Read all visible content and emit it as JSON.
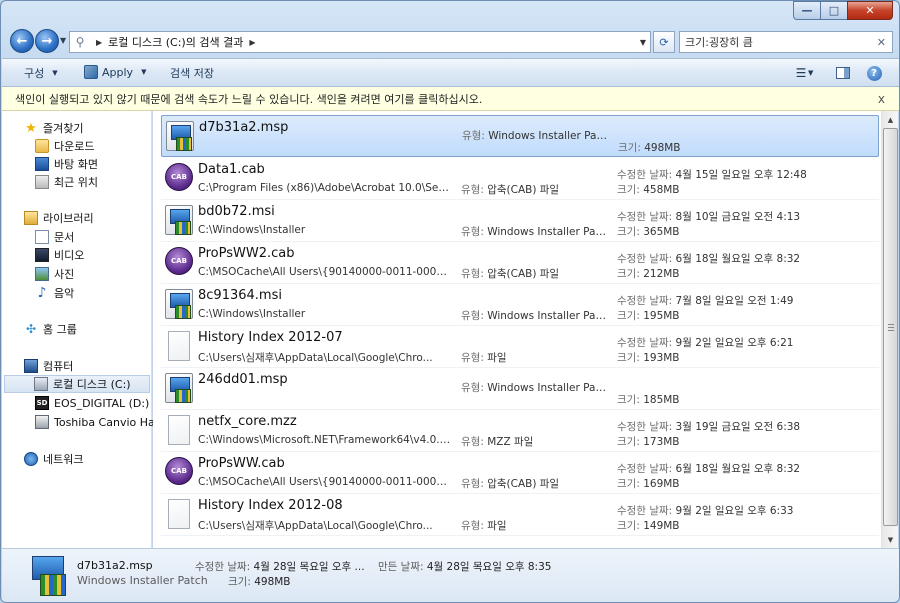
{
  "window": {
    "caption_buttons": {
      "minimize": "—",
      "maximize": "□",
      "close": "✕"
    }
  },
  "address": {
    "path": [
      "로컬 디스크 (C:)의 검색 결과"
    ],
    "search_value": "크기:굉장히 큼"
  },
  "toolbar": {
    "organize": "구성",
    "apply": "Apply",
    "save_search": "검색 저장"
  },
  "infobar": {
    "message": "색인이 실행되고 있지 않기 때문에 검색 속도가 느릴 수 있습니다. 색인을 켜려면 여기를 클릭하십시오."
  },
  "nav": {
    "favorites": "즐겨찾기",
    "downloads": "다운로드",
    "desktop": "바탕 화면",
    "recent": "최근 위치",
    "libraries": "라이브러리",
    "documents": "문서",
    "videos": "비디오",
    "pictures": "사진",
    "music": "음악",
    "homegroup": "홈 그룹",
    "computer": "컴퓨터",
    "local_disk": "로컬 디스크 (C:)",
    "eos": "EOS_DIGITAL (D:)",
    "toshiba": "Toshiba Canvio Har",
    "network": "네트워크"
  },
  "labels": {
    "type": "유형: ",
    "modified": "수정한 날짜: ",
    "size": "크기: "
  },
  "results": [
    {
      "name": "d7b31a2.msp",
      "path": "",
      "type": "Windows Installer Patch",
      "date": "",
      "size": "498MB",
      "icon": "msp-icon"
    },
    {
      "name": "Data1.cab",
      "path": "C:\\Program Files (x86)\\Adobe\\Acrobat 10.0\\Set...",
      "type": "압축(CAB) 파일",
      "date": "4월 15일 일요일 오후 12:48",
      "size": "458MB",
      "icon": "cab-icon"
    },
    {
      "name": "bd0b72.msi",
      "path": "C:\\Windows\\Installer",
      "type": "Windows Installer Pack...",
      "date": "8월 10일 금요일 오전 4:13",
      "size": "365MB",
      "icon": "msi-icon"
    },
    {
      "name": "ProPsWW2.cab",
      "path": "C:\\MSOCache\\All Users\\{90140000-0011-0000-...",
      "type": "압축(CAB) 파일",
      "date": "6월 18일 월요일 오후 8:32",
      "size": "212MB",
      "icon": "cab-icon"
    },
    {
      "name": "8c91364.msi",
      "path": "C:\\Windows\\Installer",
      "type": "Windows Installer Pack...",
      "date": "7월 8일 일요일 오전 1:49",
      "size": "195MB",
      "icon": "msi-icon"
    },
    {
      "name": "History Index 2012-07",
      "path": "C:\\Users\\심재후\\AppData\\Local\\Google\\Chro...",
      "type": "파일",
      "date": "9월 2일 일요일 오후 6:21",
      "size": "193MB",
      "icon": "file-icon"
    },
    {
      "name": "246dd01.msp",
      "path": "",
      "type": "Windows Installer Patch",
      "date": "",
      "size": "185MB",
      "icon": "msp-icon"
    },
    {
      "name": "netfx_core.mzz",
      "path": "C:\\Windows\\Microsoft.NET\\Framework64\\v4.0.3...",
      "type": "MZZ 파일",
      "date": "3월 19일 금요일 오전 6:38",
      "size": "173MB",
      "icon": "file-icon"
    },
    {
      "name": "ProPsWW.cab",
      "path": "C:\\MSOCache\\All Users\\{90140000-0011-0000-...",
      "type": "압축(CAB) 파일",
      "date": "6월 18일 월요일 오후 8:32",
      "size": "169MB",
      "icon": "cab-icon"
    },
    {
      "name": "History Index 2012-08",
      "path": "C:\\Users\\심재후\\AppData\\Local\\Google\\Chro...",
      "type": "파일",
      "date": "9월 2일 일요일 오후 6:33",
      "size": "149MB",
      "icon": "file-icon"
    }
  ],
  "details": {
    "name": "d7b31a2.msp",
    "type": "Windows Installer Patch",
    "modified_label": "수정한 날짜: ",
    "modified": "4월 28일 목요일 오후 ...",
    "created_label": "만든 날짜: ",
    "created": "4월 28일 목요일 오후 8:35",
    "size_label": "크기: ",
    "size": "498MB"
  },
  "icons": {
    "back": "◀",
    "forward": "▶",
    "search": "⚲",
    "close": "x",
    "help": "?",
    "cab_text": "CAB"
  }
}
